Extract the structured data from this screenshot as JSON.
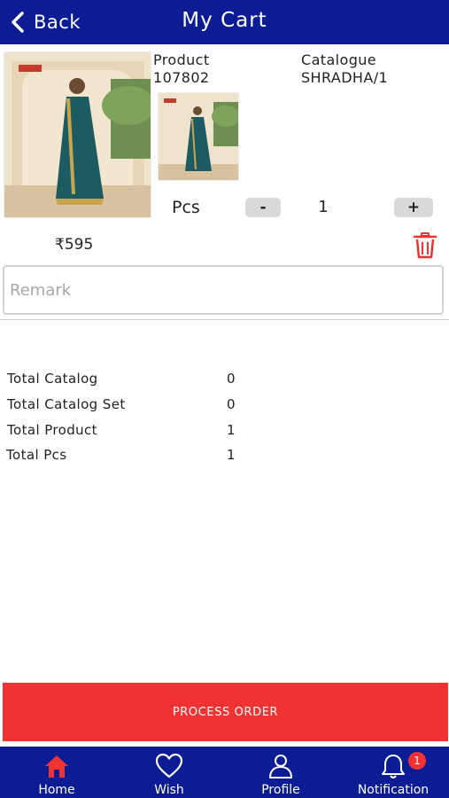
{
  "header": {
    "back_label": "Back",
    "title": "My Cart"
  },
  "cart_item": {
    "product_label": "Product",
    "product_code": "107802",
    "catalogue_label": "Catalogue",
    "catalogue_name": "SHRADHA/1",
    "pcs_label": "Pcs",
    "decrement_label": "-",
    "increment_label": "+",
    "quantity": "1",
    "price": "₹595",
    "remark_placeholder": "Remark",
    "remark_value": ""
  },
  "summary": [
    {
      "label": "Total Catalog",
      "value": "0"
    },
    {
      "label": "Total Catalog Set",
      "value": "0"
    },
    {
      "label": "Total Product",
      "value": "1"
    },
    {
      "label": "Total Pcs",
      "value": "1"
    }
  ],
  "process_label": "PROCESS ORDER",
  "tabs": [
    {
      "label": "Home",
      "icon": "home-icon"
    },
    {
      "label": "Wish",
      "icon": "heart-icon"
    },
    {
      "label": "Profile",
      "icon": "user-icon"
    },
    {
      "label": "Notification",
      "icon": "bell-icon",
      "badge": "1"
    }
  ],
  "colors": {
    "header": "#0c1c94",
    "accent": "#f13232",
    "active_tab": "#f13232",
    "stepper": "#d9d9d9"
  }
}
